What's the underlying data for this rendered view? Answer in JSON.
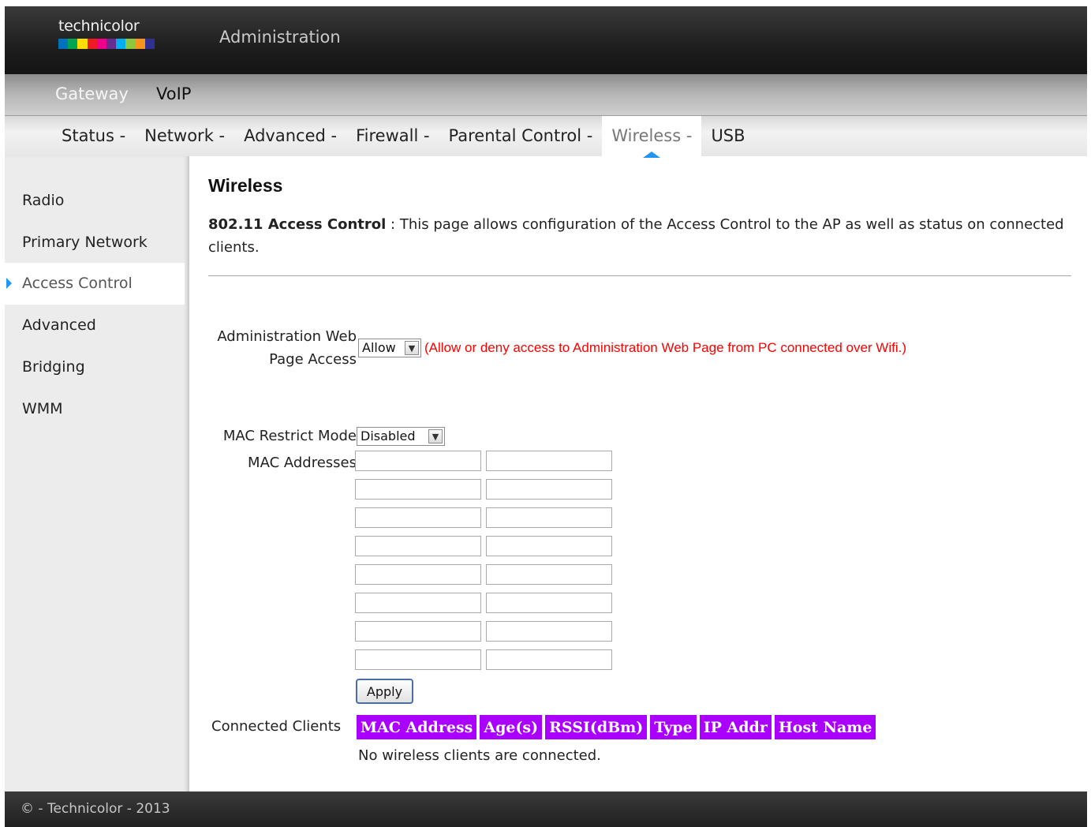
{
  "header": {
    "logo_text": "technicolor",
    "logo_colors": [
      "#0072bc",
      "#00a651",
      "#ffde00",
      "#ed1c24",
      "#ec008c",
      "#662d91",
      "#00aeef",
      "#8dc63f",
      "#f7941d",
      "#2e3192"
    ],
    "title": "Administration"
  },
  "top_nav": {
    "items": [
      "Gateway",
      "VoIP"
    ],
    "active": "Gateway"
  },
  "sub_nav": {
    "items": [
      "Status -",
      "Network -",
      "Advanced -",
      "Firewall -",
      "Parental Control -",
      "Wireless -",
      "USB"
    ],
    "active": "Wireless -",
    "indicator_color": "#2196f3"
  },
  "sidebar": {
    "items": [
      "Radio",
      "Primary Network",
      "Access Control",
      "Advanced",
      "Bridging",
      "WMM"
    ],
    "active": "Access Control"
  },
  "main": {
    "title": "Wireless",
    "description_bold": "802.11 Access Control",
    "description_text": " :  This page allows configuration of the Access Control to the AP as well as status on connected clients.",
    "admin_access_label": "Administration Web Page Access",
    "admin_access_value": "Allow",
    "admin_access_hint": "(Allow or deny access to Administration Web Page from PC connected over Wifi.)",
    "hint_color": "#ff0000",
    "mac_restrict_label": "MAC Restrict Mode",
    "mac_restrict_value": "Disabled",
    "mac_addresses_label": "MAC Addresses",
    "mac_addresses": [
      "",
      "",
      "",
      "",
      "",
      "",
      "",
      "",
      "",
      "",
      "",
      "",
      "",
      "",
      "",
      ""
    ],
    "apply_label": "Apply",
    "connected_clients_label": "Connected Clients",
    "clients_columns": [
      "MAC Address",
      "Age(s)",
      "RSSI(dBm)",
      "Type",
      "IP Addr",
      "Host Name"
    ],
    "clients_header_color": "#aa00ff",
    "no_clients_text": "No wireless clients are connected."
  },
  "footer": {
    "text": "© - Technicolor - 2013"
  }
}
